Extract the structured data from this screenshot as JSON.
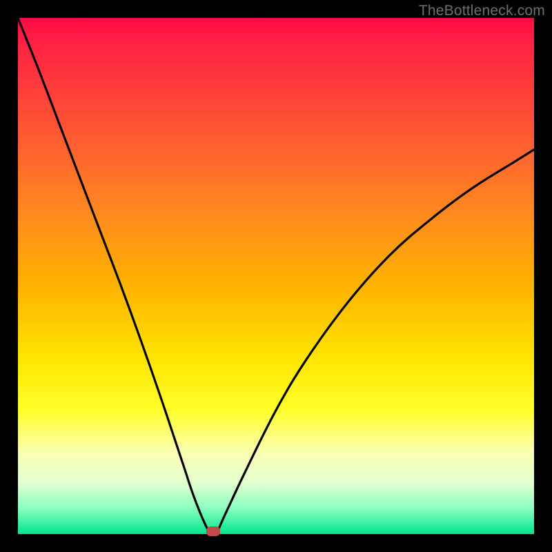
{
  "watermark": "TheBottleneck.com",
  "colors": {
    "page_bg": "#000000",
    "gradient_top": "#ff0b46",
    "gradient_bottom": "#00e58e",
    "curve": "#000000",
    "marker": "#c24a47"
  },
  "chart_data": {
    "type": "line",
    "title": "",
    "xlabel": "",
    "ylabel": "",
    "xlim": [
      0,
      100
    ],
    "ylim": [
      0,
      100
    ],
    "grid": false,
    "legend": false,
    "series": [
      {
        "name": "bottleneck-curve",
        "x": [
          0,
          4,
          8,
          12,
          16,
          20,
          24,
          28,
          32,
          34,
          36,
          37.2,
          38.5,
          40,
          44,
          50,
          56,
          64,
          72,
          80,
          88,
          96,
          100
        ],
        "y": [
          100,
          90,
          79.5,
          69,
          58.5,
          48,
          37,
          25.5,
          13.5,
          7.5,
          2.5,
          0.4,
          0.4,
          3.5,
          12,
          24,
          34,
          45,
          54,
          61,
          67,
          72,
          74.5
        ]
      }
    ],
    "marker": {
      "x": 37.8,
      "y": 0.6
    },
    "annotations": []
  }
}
